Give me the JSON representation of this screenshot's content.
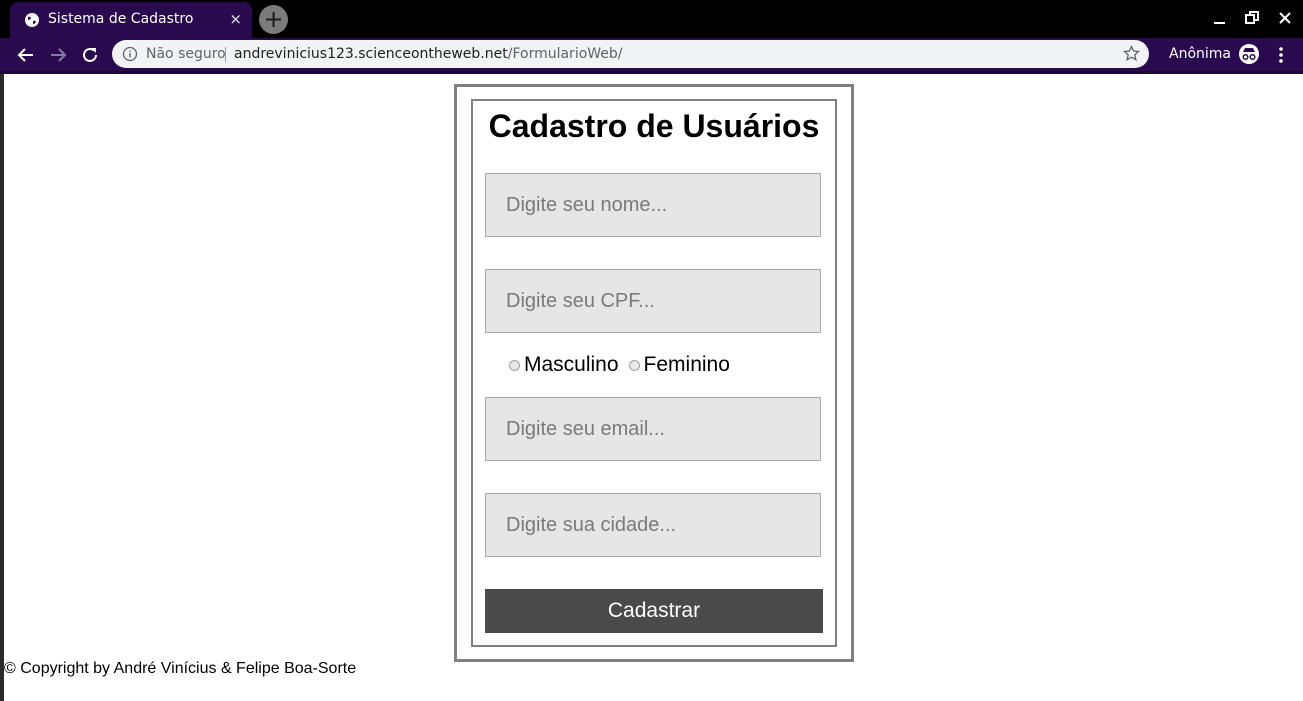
{
  "browser": {
    "tab_title": "Sistema de Cadastro",
    "tab_close": "×",
    "new_tab": "+",
    "security_label": "Não seguro",
    "url_host": "andrevinicius123.scienceontheweb.net",
    "url_path": "/FormularioWeb/",
    "profile_label": "Anônima",
    "colors": {
      "frame": "#2a0a4e",
      "titlebar": "#000000",
      "omnibox": "#f1f3f4"
    }
  },
  "form": {
    "title": "Cadastro de Usuários",
    "fields": {
      "nome_placeholder": "Digite seu nome...",
      "cpf_placeholder": "Digite seu CPF...",
      "email_placeholder": "Digite seu email...",
      "cidade_placeholder": "Digite sua cidade..."
    },
    "gender": {
      "option_male": "Masculino",
      "option_female": "Feminino"
    },
    "submit_label": "Cadastrar",
    "colors": {
      "field_bg": "#e6e6e6",
      "button_bg": "#4a4a4a",
      "border": "#808080"
    }
  },
  "footer": {
    "text": "© Copyright by André Vinícius & Felipe Boa-Sorte"
  }
}
